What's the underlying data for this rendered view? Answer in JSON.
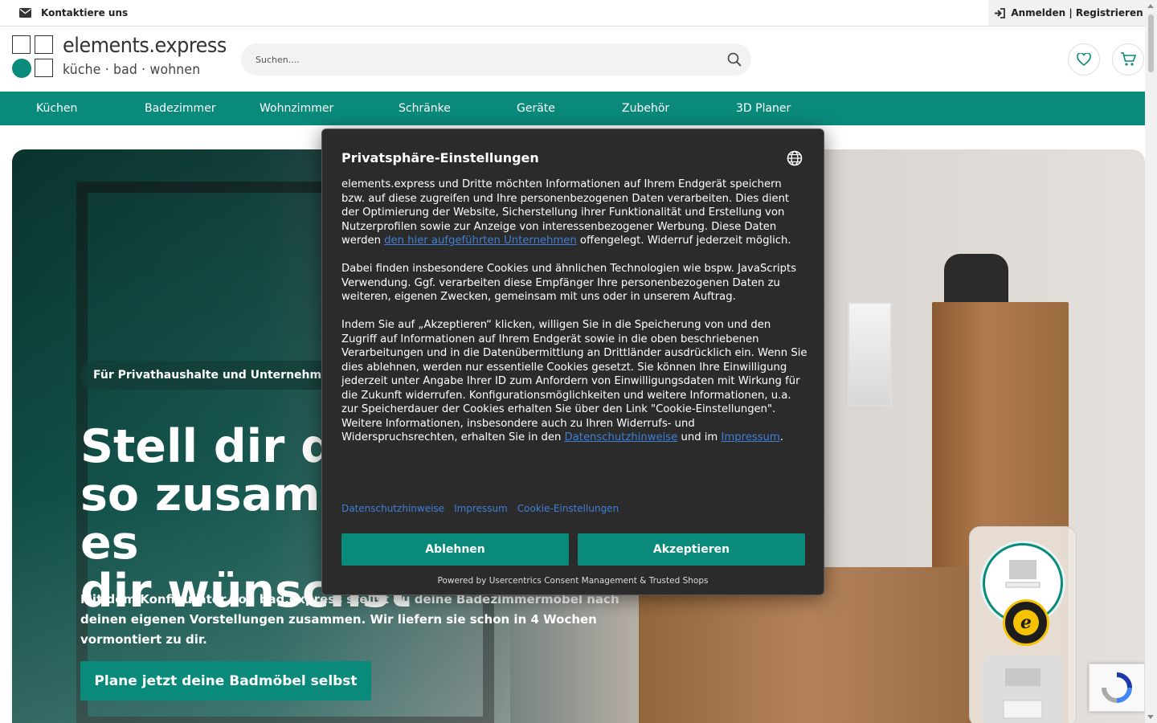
{
  "topbar": {
    "contact_label": "Kontaktiere uns",
    "login_label": "Anmelden | Registrieren"
  },
  "header": {
    "logo_name": "elements.express",
    "logo_tagline": "küche · bad · wohnen",
    "search_placeholder": "Suchen...."
  },
  "nav": {
    "items": [
      {
        "label": "Küchen"
      },
      {
        "label": "Badezimmer"
      },
      {
        "label": "Wohnzimmer"
      },
      {
        "label": "Schränke"
      },
      {
        "label": "Geräte"
      },
      {
        "label": "Zubehör"
      },
      {
        "label": "3D Planer"
      }
    ]
  },
  "hero": {
    "badge": "Für Privathaushalte und Unternehmen",
    "title": "Stell dir dein Bad\nso zusammen, wie du es\ndir wünschst",
    "text": "Mit dem Konfigurator von bad.express stellst du deine Badezimmermöbel nach deinen eigenen Vorstellungen zusammen. Wir liefern sie schon in 4 Wochen vormontiert zu dir.",
    "cta_label": "Plane jetzt deine Badmöbel selbst"
  },
  "consent": {
    "title": "Privatsphäre-Einstellungen",
    "p1_before": "elements.express und Dritte möchten Informationen auf Ihrem Endgerät speichern bzw. auf diese zugreifen und Ihre personenbezogenen Daten verarbeiten. Dies dient der Optimierung der Website, Sicherstellung ihrer Funktionalität und Erstellung von Nutzerprofilen sowie zur Anzeige von interessenbezogener Werbung. Diese Daten werden ",
    "p1_link": "den hier aufgeführten Unternehmen",
    "p1_after": " offengelegt. Widerruf jederzeit möglich.",
    "p2": "Dabei finden insbesondere Cookies und ähnlichen Technologien wie bspw. JavaScripts Verwendung. Ggf. verarbeiten diese Empfänger Ihre personenbezogenen Daten zu weiteren, eigenen Zwecken, gemeinsam mit uns oder in unserem Auftrag.",
    "p3_before": "Indem Sie auf „Akzeptieren“ klicken, willigen Sie in die Speicherung von und den Zugriff auf Informationen auf Ihrem Endgerät sowie in die oben beschriebenen Verarbeitungen und in die Datenübermittlung an Drittländer ausdrücklich ein. Wenn Sie dies ablehnen, werden nur essentielle Cookies gesetzt. Sie können Ihre Einwilligung jederzeit unter Angabe Ihrer ID zum Anfordern von Einwilligungsdaten mit Wirkung für die Zukunft widerrufen. Konfigurationsmöglichkeiten und weitere Informationen, u.a. zur Speicherdauer der Cookies erhalten Sie über den Link \"Cookie-Einstellungen\". Weitere Informationen, insbesondere auch zu Ihren Widerrufs- und Widerspruchsrechten, erhalten Sie in den ",
    "p3_link1": "Datenschutzhinweise",
    "p3_mid": " und im ",
    "p3_link2": "Impressum",
    "p3_end": ".",
    "links": [
      "Datenschutzhinweise",
      "Impressum",
      "Cookie-Einstellungen"
    ],
    "decline_label": "Ablehnen",
    "accept_label": "Akzeptieren",
    "powered_by": "Powered by Usercentrics Consent Management & Trusted Shops"
  },
  "colors": {
    "brand": "#0a8a7a",
    "modal_bg": "#2b2b2b",
    "link": "#3f7fd6"
  }
}
